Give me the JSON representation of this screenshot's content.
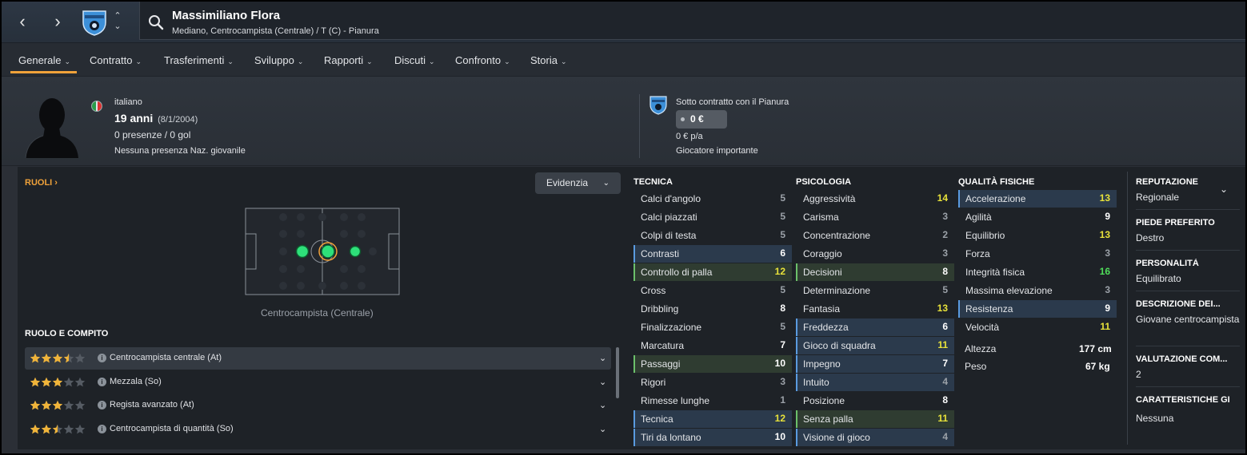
{
  "header": {
    "player_name": "Massimiliano Flora",
    "player_sub": "Mediano, Centrocampista (Centrale) / T (C) - Pianura",
    "back_glyph": "‹",
    "forward_glyph": "›",
    "up_glyph": "⌃",
    "down_glyph": "⌄"
  },
  "tabs": [
    {
      "label": "Generale"
    },
    {
      "label": "Contratto"
    },
    {
      "label": "Trasferimenti"
    },
    {
      "label": "Sviluppo"
    },
    {
      "label": "Rapporti"
    },
    {
      "label": "Discuti"
    },
    {
      "label": "Confronto"
    },
    {
      "label": "Storia"
    }
  ],
  "tab_chevron": "⌄",
  "profile": {
    "nationality": "italiano",
    "age": "19 anni",
    "dob": "(8/1/2004)",
    "appearances": "0 presenze / 0 gol",
    "youth": "Nessuna presenza Naz. giovanile"
  },
  "contract": {
    "text": "Sotto contratto con il Pianura",
    "wage": "0 €",
    "wage_pa": "0 € p/a",
    "squad_status": "Giocatore importante"
  },
  "roles": {
    "link_label": "RUOLI ›",
    "highlight_label": "Evidenzia",
    "highlight_chevron": "⌄",
    "pitch_caption": "Centrocampista (Centrale)",
    "heading": "RUOLO E COMPITO",
    "info_glyph": "i",
    "row_chevron": "⌄",
    "items": [
      {
        "name": "Centrocampista centrale (At)",
        "stars": 3.5
      },
      {
        "name": "Mezzala (So)",
        "stars": 3
      },
      {
        "name": "Regista avanzato (At)",
        "stars": 3
      },
      {
        "name": "Centrocampista di quantità (So)",
        "stars": 2.5
      }
    ]
  },
  "attributes": {
    "tecnica": {
      "title": "TECNICA",
      "items": [
        {
          "name": "Calci d'angolo",
          "value": "5",
          "hl": ""
        },
        {
          "name": "Calci piazzati",
          "value": "5",
          "hl": ""
        },
        {
          "name": "Colpi di testa",
          "value": "5",
          "hl": ""
        },
        {
          "name": "Contrasti",
          "value": "6",
          "hl": "blue"
        },
        {
          "name": "Controllo di palla",
          "value": "12",
          "hl": "green"
        },
        {
          "name": "Cross",
          "value": "5",
          "hl": ""
        },
        {
          "name": "Dribbling",
          "value": "8",
          "hl": ""
        },
        {
          "name": "Finalizzazione",
          "value": "5",
          "hl": ""
        },
        {
          "name": "Marcatura",
          "value": "7",
          "hl": ""
        },
        {
          "name": "Passaggi",
          "value": "10",
          "hl": "green"
        },
        {
          "name": "Rigori",
          "value": "3",
          "hl": ""
        },
        {
          "name": "Rimesse lunghe",
          "value": "1",
          "hl": ""
        },
        {
          "name": "Tecnica",
          "value": "12",
          "hl": "blue"
        },
        {
          "name": "Tiri da lontano",
          "value": "10",
          "hl": "blue"
        }
      ]
    },
    "psicologia": {
      "title": "PSICOLOGIA",
      "items": [
        {
          "name": "Aggressività",
          "value": "14",
          "hl": ""
        },
        {
          "name": "Carisma",
          "value": "3",
          "hl": ""
        },
        {
          "name": "Concentrazione",
          "value": "2",
          "hl": ""
        },
        {
          "name": "Coraggio",
          "value": "3",
          "hl": ""
        },
        {
          "name": "Decisioni",
          "value": "8",
          "hl": "green"
        },
        {
          "name": "Determinazione",
          "value": "5",
          "hl": ""
        },
        {
          "name": "Fantasia",
          "value": "13",
          "hl": ""
        },
        {
          "name": "Freddezza",
          "value": "6",
          "hl": "blue"
        },
        {
          "name": "Gioco di squadra",
          "value": "11",
          "hl": "blue"
        },
        {
          "name": "Impegno",
          "value": "7",
          "hl": "blue"
        },
        {
          "name": "Intuito",
          "value": "4",
          "hl": "blue"
        },
        {
          "name": "Posizione",
          "value": "8",
          "hl": ""
        },
        {
          "name": "Senza palla",
          "value": "11",
          "hl": "green"
        },
        {
          "name": "Visione di gioco",
          "value": "4",
          "hl": "blue"
        }
      ]
    },
    "fisiche": {
      "title": "QUALITÀ FISICHE",
      "items": [
        {
          "name": "Accelerazione",
          "value": "13",
          "hl": "blue"
        },
        {
          "name": "Agilità",
          "value": "9",
          "hl": ""
        },
        {
          "name": "Equilibrio",
          "value": "13",
          "hl": ""
        },
        {
          "name": "Forza",
          "value": "3",
          "hl": ""
        },
        {
          "name": "Integrità fisica",
          "value": "16",
          "hl": ""
        },
        {
          "name": "Massima elevazione",
          "value": "3",
          "hl": ""
        },
        {
          "name": "Resistenza",
          "value": "9",
          "hl": "blue"
        },
        {
          "name": "Velocità",
          "value": "11",
          "hl": ""
        }
      ],
      "height_label": "Altezza",
      "height_value": "177 cm",
      "weight_label": "Peso",
      "weight_value": "67 kg"
    }
  },
  "info": [
    {
      "label": "REPUTAZIONE",
      "value": "Regionale"
    },
    {
      "label": "PIEDE PREFERITO",
      "value": "Destro"
    },
    {
      "label": "PERSONALITÀ",
      "value": "Equilibrato"
    },
    {
      "label": "DESCRIZIONE DEI...",
      "value": "Giovane centrocampista"
    },
    {
      "label": "VALUTAZIONE COM...",
      "value": "2"
    },
    {
      "label": "CARATTERISTICHE GI",
      "value": "Nessuna"
    }
  ],
  "info_chevron": "⌄",
  "colors": {
    "accent": "#f0a23a",
    "val_high": "#e8e23a",
    "val_vhigh": "#4fdd5a",
    "val_mid": "#ffffff",
    "val_low": "#9ba1a8",
    "pitch_dot": "#2ee07a"
  }
}
